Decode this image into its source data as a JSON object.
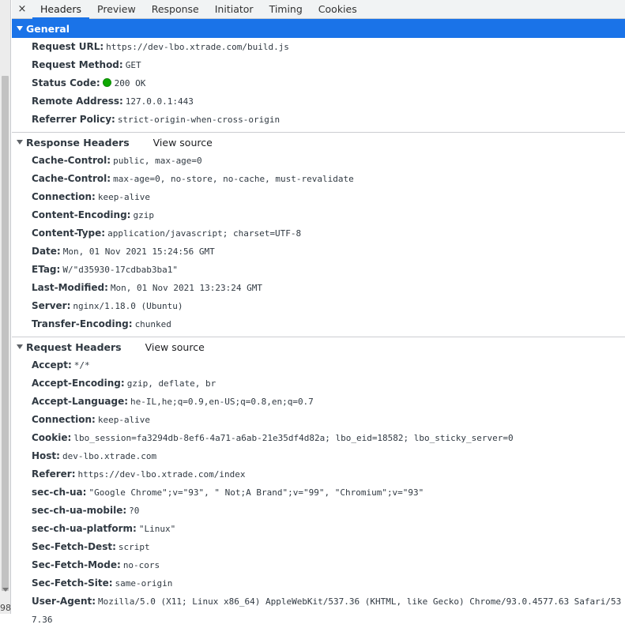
{
  "tabs": [
    {
      "label": "Headers",
      "active": true
    },
    {
      "label": "Preview"
    },
    {
      "label": "Response"
    },
    {
      "label": "Initiator"
    },
    {
      "label": "Timing"
    },
    {
      "label": "Cookies"
    }
  ],
  "close_symbol": "×",
  "gutter_number": "98",
  "general": {
    "title": "General",
    "rows": [
      {
        "name": "Request URL:",
        "value": "https://dev-lbo.xtrade.com/build.js"
      },
      {
        "name": "Request Method:",
        "value": "GET"
      },
      {
        "name": "Status Code:",
        "value": "200 OK",
        "status_color": "#0ea800"
      },
      {
        "name": "Remote Address:",
        "value": "127.0.0.1:443"
      },
      {
        "name": "Referrer Policy:",
        "value": "strict-origin-when-cross-origin"
      }
    ]
  },
  "response_headers": {
    "title": "Response Headers",
    "view_source": "View source",
    "rows": [
      {
        "name": "Cache-Control:",
        "value": "public, max-age=0"
      },
      {
        "name": "Cache-Control:",
        "value": "max-age=0, no-store, no-cache, must-revalidate"
      },
      {
        "name": "Connection:",
        "value": "keep-alive"
      },
      {
        "name": "Content-Encoding:",
        "value": "gzip"
      },
      {
        "name": "Content-Type:",
        "value": "application/javascript; charset=UTF-8"
      },
      {
        "name": "Date:",
        "value": "Mon, 01 Nov 2021 15:24:56 GMT"
      },
      {
        "name": "ETag:",
        "value": "W/\"d35930-17cdbab3ba1\""
      },
      {
        "name": "Last-Modified:",
        "value": "Mon, 01 Nov 2021 13:23:24 GMT"
      },
      {
        "name": "Server:",
        "value": "nginx/1.18.0 (Ubuntu)"
      },
      {
        "name": "Transfer-Encoding:",
        "value": "chunked"
      }
    ]
  },
  "request_headers": {
    "title": "Request Headers",
    "view_source": "View source",
    "rows": [
      {
        "name": "Accept:",
        "value": "*/*"
      },
      {
        "name": "Accept-Encoding:",
        "value": "gzip, deflate, br"
      },
      {
        "name": "Accept-Language:",
        "value": "he-IL,he;q=0.9,en-US;q=0.8,en;q=0.7"
      },
      {
        "name": "Connection:",
        "value": "keep-alive"
      },
      {
        "name": "Cookie:",
        "value": "lbo_session=fa3294db-8ef6-4a71-a6ab-21e35df4d82a; lbo_eid=18582; lbo_sticky_server=0"
      },
      {
        "name": "Host:",
        "value": "dev-lbo.xtrade.com"
      },
      {
        "name": "Referer:",
        "value": "https://dev-lbo.xtrade.com/index"
      },
      {
        "name": "sec-ch-ua:",
        "value": "\"Google Chrome\";v=\"93\", \" Not;A Brand\";v=\"99\", \"Chromium\";v=\"93\""
      },
      {
        "name": "sec-ch-ua-mobile:",
        "value": "?0"
      },
      {
        "name": "sec-ch-ua-platform:",
        "value": "\"Linux\""
      },
      {
        "name": "Sec-Fetch-Dest:",
        "value": "script"
      },
      {
        "name": "Sec-Fetch-Mode:",
        "value": "no-cors"
      },
      {
        "name": "Sec-Fetch-Site:",
        "value": "same-origin"
      },
      {
        "name": "User-Agent:",
        "value": "Mozilla/5.0 (X11; Linux x86_64) AppleWebKit/537.36 (KHTML, like Gecko) Chrome/93.0.4577.63 Safari/537.36"
      }
    ]
  },
  "colors": {
    "accent": "#1a73e8",
    "status_ok": "#0ea800"
  }
}
